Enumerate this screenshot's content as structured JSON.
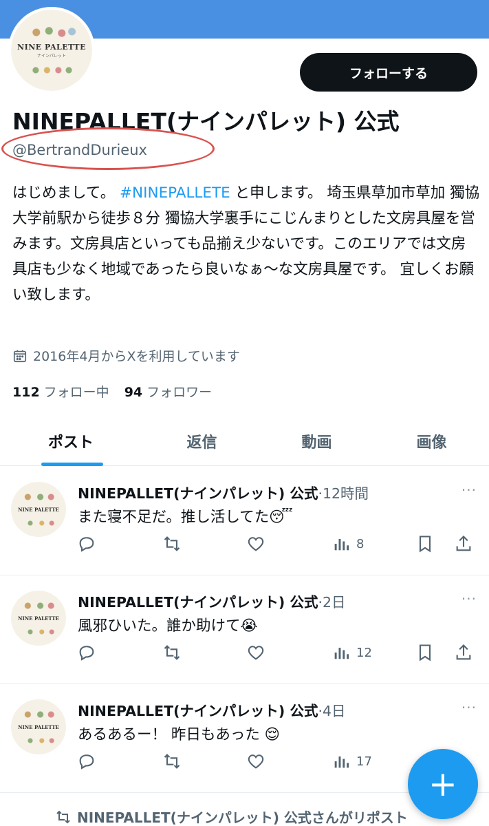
{
  "profile": {
    "avatar_brand": "NINE PALETTE",
    "avatar_sub": "ナインパレット",
    "follow_label": "フォローする",
    "display_name": "NINEPALLET(ナインパレット) 公式",
    "handle": "@BertrandDurieux",
    "bio_before": "はじめまして。 ",
    "bio_hashtag": "#NINEPALLETE",
    "bio_after": " と申します。 埼玉県草加市草加 獨協大学前駅から徒歩８分 獨協大学裏手にこじんまりとした文房具屋を営みます。文房具店といっても品揃え少ないです。このエリアでは文房具店も少なく地域であったら良いなぁ〜な文房具屋です。 宜しくお願い致します。",
    "joined": "2016年4月からXを利用しています",
    "following_count": "112",
    "following_label": "フォロー中",
    "followers_count": "94",
    "followers_label": "フォロワー"
  },
  "tabs": [
    "ポスト",
    "返信",
    "動画",
    "画像"
  ],
  "posts": [
    {
      "name": "NINEPALLET(ナインパレット) 公式",
      "time": "·12時間",
      "text": "また寝不足だ。推し活してた😴",
      "views": "8"
    },
    {
      "name": "NINEPALLET(ナインパレット) 公式",
      "time": "·2日",
      "text": "風邪ひいた。誰か助けて😭",
      "views": "12"
    },
    {
      "name": "NINEPALLET(ナインパレット) 公式",
      "time": "·4日",
      "text": "あるあるー！ 昨日もあった 😌",
      "views": "17"
    }
  ],
  "more_icon": "···",
  "repost_notice": "NINEPALLET(ナインパレット) 公式さんがリポスト",
  "fab_label": "+",
  "colors": {
    "banner": "#4a90e2",
    "accent": "#1d9bf0",
    "highlight_circle": "#d9534f"
  }
}
